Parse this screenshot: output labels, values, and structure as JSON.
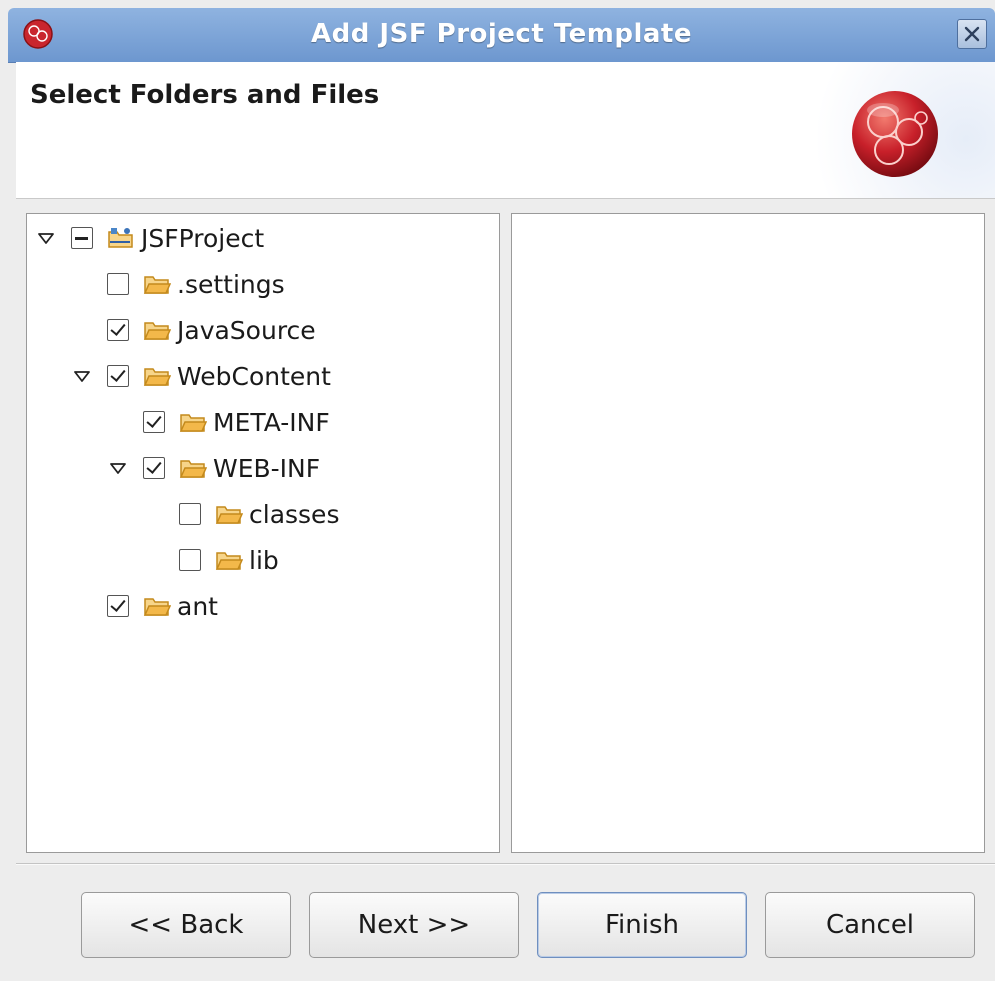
{
  "window": {
    "title": "Add JSF Project Template"
  },
  "header": {
    "title": "Select Folders and Files"
  },
  "tree": [
    {
      "label": "JSFProject",
      "state": "partial",
      "expanded": true,
      "icon": "project-icon",
      "depth": 0,
      "twisty": true
    },
    {
      "label": ".settings",
      "state": "unchecked",
      "icon": "folder-icon",
      "depth": 1
    },
    {
      "label": "JavaSource",
      "state": "checked",
      "icon": "folder-icon",
      "depth": 1
    },
    {
      "label": "WebContent",
      "state": "checked",
      "icon": "folder-icon",
      "depth": 1,
      "twisty": true,
      "expanded": true
    },
    {
      "label": "META-INF",
      "state": "checked",
      "icon": "folder-icon",
      "depth": 2
    },
    {
      "label": "WEB-INF",
      "state": "checked",
      "icon": "folder-icon",
      "depth": 2,
      "twisty": true,
      "expanded": true
    },
    {
      "label": "classes",
      "state": "unchecked",
      "icon": "folder-icon",
      "depth": 3
    },
    {
      "label": "lib",
      "state": "unchecked",
      "icon": "folder-icon",
      "depth": 3
    },
    {
      "label": "ant",
      "state": "checked",
      "icon": "folder-icon",
      "depth": 1
    }
  ],
  "buttons": {
    "back": "<< Back",
    "next": "Next >>",
    "finish": "Finish",
    "cancel": "Cancel"
  },
  "colors": {
    "titlebar": "#7aa2d8",
    "folder": "#f0b84a",
    "logo": "#c8202a"
  }
}
